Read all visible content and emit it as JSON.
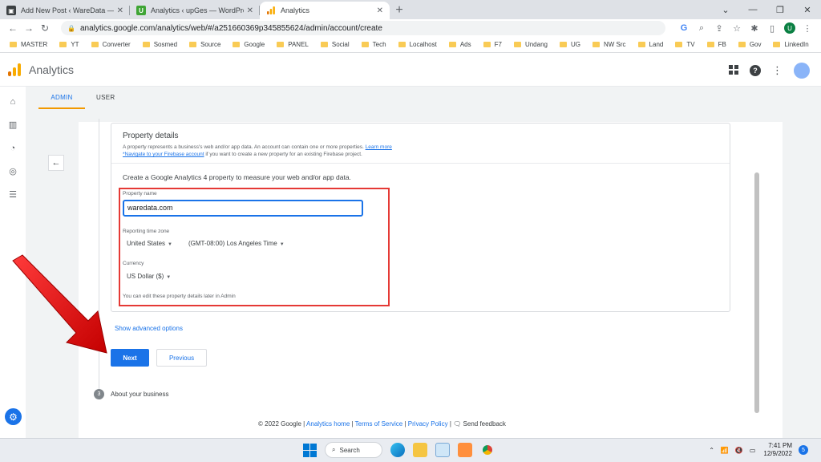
{
  "browser": {
    "tabs": [
      {
        "title": "Add New Post ‹ WareData — Wo",
        "favicon_color": "#3c4043"
      },
      {
        "title": "Analytics ‹ upGes — WordPress",
        "favicon_color": "#3fa535"
      },
      {
        "title": "Analytics",
        "favicon_color": "#f9ab00"
      }
    ],
    "url": "analytics.google.com/analytics/web/#/a251660369p345855624/admin/account/create",
    "profile_initial": "U",
    "bookmarks": [
      "MASTER",
      "YT",
      "Converter",
      "Sosmed",
      "Source",
      "Google",
      "PANEL",
      "Social",
      "Tech",
      "Localhost",
      "Ads",
      "F7",
      "Undang",
      "UG",
      "NW Src",
      "Land",
      "TV",
      "FB",
      "Gov",
      "LinkedIn"
    ]
  },
  "app": {
    "title": "Analytics",
    "brand_colors": [
      "#f9ab00",
      "#e37400"
    ],
    "admin_tabs": [
      "ADMIN",
      "USER"
    ]
  },
  "property": {
    "title": "Property details",
    "description": "A property represents a business's web and/or app data. An account can contain one or more properties.",
    "learn_more": "Learn more",
    "firebase_link": "*Navigate to your Firebase account",
    "firebase_text": "if you want to create a new property for an existing Firebase project.",
    "create_text": "Create a Google Analytics 4 property to measure your web and/or app data.",
    "name_label": "Property name",
    "name_value": "waredata.com",
    "timezone_label": "Reporting time zone",
    "timezone_country": "United States",
    "timezone_value": "(GMT-08:00) Los Angeles Time",
    "currency_label": "Currency",
    "currency_value": "US Dollar ($)",
    "note": "You can edit these property details later in Admin",
    "show_advanced": "Show advanced options",
    "next_label": "Next",
    "previous_label": "Previous",
    "step_number": "3",
    "step_label": "About your business"
  },
  "footer": {
    "copyright": "© 2022 Google",
    "analytics_home": "Analytics home",
    "terms": "Terms of Service",
    "privacy": "Privacy Policy",
    "feedback": "Send feedback",
    "sep": "|"
  },
  "taskbar": {
    "search_label": "Search",
    "time": "7:41 PM",
    "date": "12/9/2022",
    "notification_count": "5"
  },
  "colors": {
    "accent": "#1a73e8",
    "highlight_box": "#e53935",
    "arrow": "#e21b1b"
  }
}
